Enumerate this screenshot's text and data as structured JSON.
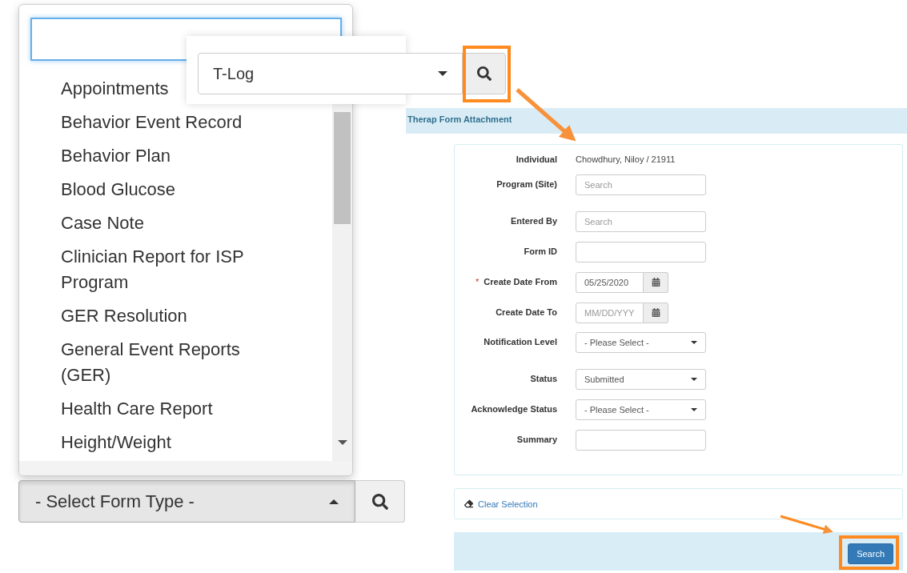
{
  "form_type_dropdown": {
    "options": [
      "Appointments",
      "Behavior Event Record",
      "Behavior Plan",
      "Blood Glucose",
      "Case Note",
      "Clinician Report for ISP Program",
      "GER Resolution",
      "General Event Reports (GER)",
      "Health Care Report",
      "Height/Weight"
    ]
  },
  "form_type_select": {
    "placeholder": "- Select Form Type -",
    "expanded": true
  },
  "callout": {
    "select_value": "T-Log"
  },
  "panel": {
    "title": "Therap Form Attachment",
    "fields": [
      {
        "label": "Individual",
        "kind": "text",
        "value": "Chowdhury, Niloy / 21911"
      },
      {
        "label": "Program (Site)",
        "kind": "input",
        "placeholder": "Search"
      },
      {
        "label": "Entered By",
        "kind": "input",
        "placeholder": "Search"
      },
      {
        "label": "Form ID",
        "kind": "input"
      },
      {
        "label": "Create Date From",
        "kind": "date",
        "value": "05/25/2020",
        "required_mark": "*"
      },
      {
        "label": "Create Date To",
        "kind": "date",
        "placeholder": "MM/DD/YYY"
      },
      {
        "label": "Notification Level",
        "kind": "select",
        "value": "- Please Select -"
      },
      {
        "label": "Status",
        "kind": "select",
        "value": "Submitted"
      },
      {
        "label": "Acknowledge Status",
        "kind": "select",
        "value": "- Please Select -"
      },
      {
        "label": "Summary",
        "kind": "input"
      }
    ],
    "clear_link": "Clear Selection",
    "search_button": "Search"
  }
}
